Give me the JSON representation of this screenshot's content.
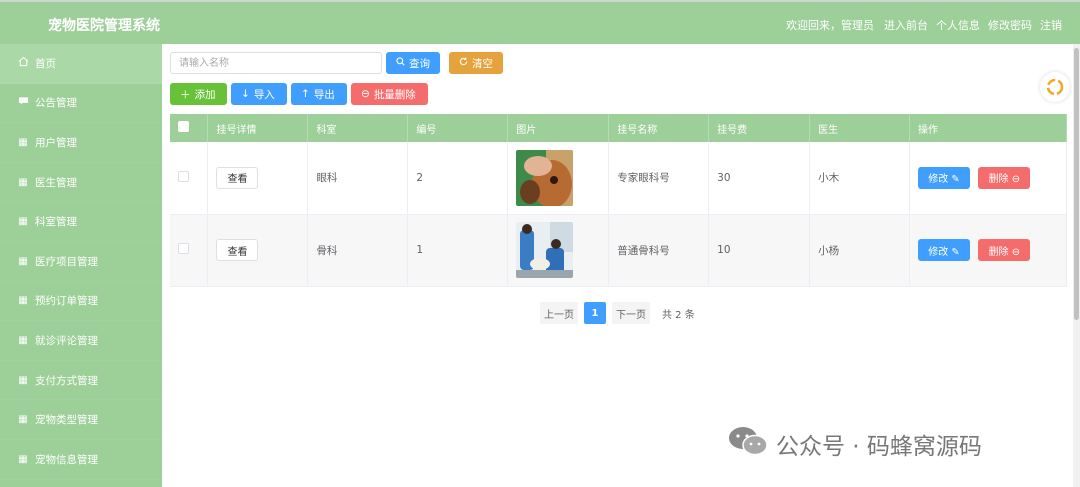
{
  "app": {
    "title": "宠物医院管理系统"
  },
  "topnav": {
    "welcome": "欢迎回来，管理员",
    "frontend": "进入前台",
    "profile": "个人信息",
    "password": "修改密码",
    "logout": "注销"
  },
  "sidebar": {
    "items": [
      {
        "label": "首页",
        "icon": "home-icon"
      },
      {
        "label": "公告管理",
        "icon": "message-icon"
      },
      {
        "label": "用户管理",
        "icon": "grid-icon"
      },
      {
        "label": "医生管理",
        "icon": "grid-icon"
      },
      {
        "label": "科室管理",
        "icon": "grid-icon"
      },
      {
        "label": "医疗项目管理",
        "icon": "grid-icon"
      },
      {
        "label": "预约订单管理",
        "icon": "grid-icon"
      },
      {
        "label": "就诊评论管理",
        "icon": "grid-icon"
      },
      {
        "label": "支付方式管理",
        "icon": "grid-icon"
      },
      {
        "label": "宠物类型管理",
        "icon": "grid-icon"
      },
      {
        "label": "宠物信息管理",
        "icon": "grid-icon"
      }
    ]
  },
  "search": {
    "placeholder": "请输入名称",
    "query_label": "查询",
    "clear_label": "清空"
  },
  "actions": {
    "add": "添加",
    "import": "导入",
    "export": "导出",
    "batch_delete": "批量删除"
  },
  "table": {
    "headers": [
      "挂号详情",
      "科室",
      "编号",
      "图片",
      "挂号名称",
      "挂号费",
      "医生",
      "操作"
    ],
    "rows": [
      {
        "detail": "查看",
        "dept": "眼科",
        "no": "2",
        "name": "专家眼科号",
        "fee": "30",
        "doctor": "小木",
        "edit": "修改",
        "delete": "删除"
      },
      {
        "detail": "查看",
        "dept": "骨科",
        "no": "1",
        "name": "普通骨科号",
        "fee": "10",
        "doctor": "小杨",
        "edit": "修改",
        "delete": "删除"
      }
    ]
  },
  "pager": {
    "prev": "上一页",
    "current": "1",
    "next": "下一页",
    "total": "共 2 条"
  },
  "watermark": {
    "text": "公众号 · 码蜂窝源码"
  },
  "colors": {
    "sidebar": "#9dcf99",
    "primary": "#409eff",
    "danger": "#f56c6c",
    "warning": "#e6a23c",
    "success": "#67c23a"
  }
}
